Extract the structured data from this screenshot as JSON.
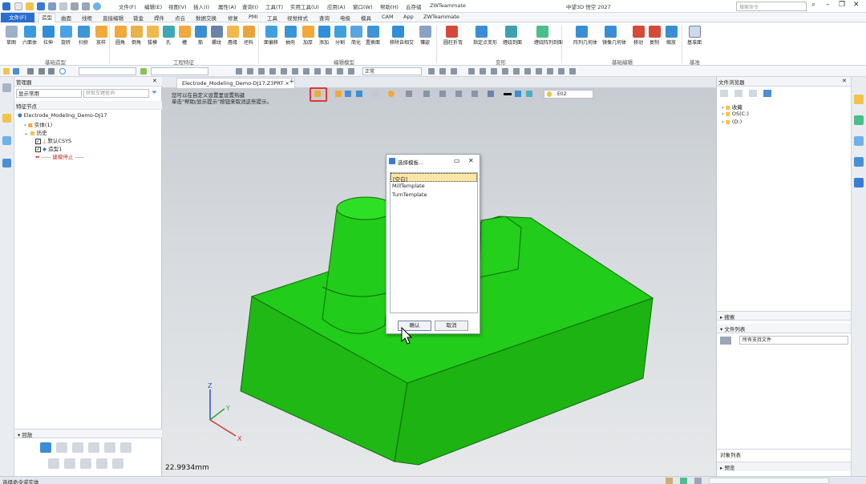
{
  "app": {
    "title": "中望3D 悟空 2027",
    "search_placeholder": "搜索命令"
  },
  "menu": [
    "文件(F)",
    "编辑(E)",
    "视图(V)",
    "插入(I)",
    "属性(A)",
    "查询(I)",
    "工具(T)",
    "实用工具(U)",
    "应用(A)",
    "窗口(W)",
    "帮助(H)",
    "云存储",
    "ZWTeammate"
  ],
  "ribbon_tabs": [
    "文件(F)",
    "造型",
    "曲面",
    "线框",
    "直接编辑",
    "钣金",
    "焊件",
    "点云",
    "数据交换",
    "修复",
    "PMI",
    "工具",
    "视觉样式",
    "查询",
    "电极",
    "模具",
    "CAM",
    "App",
    "ZWTeammate"
  ],
  "active_tab": "造型",
  "ribbon": {
    "basic": {
      "label": "基础造型",
      "buttons": [
        "草图",
        "六面体",
        "拉伸",
        "旋转",
        "扫掠",
        "放样"
      ]
    },
    "eng": {
      "label": "工程特征",
      "buttons": [
        "圆角",
        "倒角",
        "拔模",
        "孔",
        "槽",
        "筋",
        "螺纹",
        "唇缘",
        "坯料"
      ]
    },
    "edit": {
      "label": "编辑模型",
      "buttons": [
        "面偏移",
        "抽壳",
        "加厚",
        "添加",
        "分割",
        "简化",
        "置换面",
        "移除自相交",
        "镶嵌"
      ]
    },
    "deform": {
      "label": "变形",
      "buttons": [
        "圆柱折弯",
        "指定点变形",
        "缠绕到面",
        "缠绕阵列到面"
      ]
    },
    "basicedit": {
      "label": "基础编辑",
      "buttons": [
        "阵列几何体",
        "镜像几何体",
        "移动",
        "复制",
        "缩放"
      ]
    },
    "datum": {
      "label": "基准",
      "buttons": [
        "基准面"
      ]
    }
  },
  "toolrow": {
    "combo1": "",
    "combo2": "",
    "style_combo": "正常"
  },
  "manager": {
    "title": "管理器",
    "filter": "显示常用",
    "search_placeholder": "获取车键查询",
    "section": "特征节点",
    "tree": {
      "root": "Electrode_Modeling_Demo-DJ17",
      "solid": "实体(1)",
      "history": "历史",
      "csys": "默认CSYS",
      "shape": "造型1",
      "stop": "----- 建模停止 -----"
    },
    "playback": "回放"
  },
  "document": {
    "tab": "Electrode_Modeling_Demo-DJ17.Z3PRT",
    "hint1": "您可以在自定义设置里设置热键",
    "hint2": "单击\"帮助/显示提示\"按钮来取消这些提示。",
    "measure": "22.9934mm",
    "view_combo": "E02",
    "axes": {
      "x": "X",
      "y": "Y",
      "z": "Z"
    }
  },
  "dialog": {
    "title": "选择模板...",
    "items": [
      "[空白]",
      "MillTemplate",
      "TurnTemplate"
    ],
    "selected": 0,
    "ok": "确认",
    "cancel": "取消"
  },
  "browser": {
    "title": "文件浏览器",
    "tree": [
      "收藏",
      "OS(C:)",
      "(D:)"
    ],
    "sections": {
      "search": "搜索",
      "filelist": "文件列表",
      "objlist": "对象列表",
      "preview": "预览"
    },
    "filter": "所有支持文件"
  },
  "status": {
    "text": "选择命令或实体"
  },
  "colors": {
    "model": "#22cc1a",
    "model_edge": "#0f6d0a",
    "accent": "#2a6fd0",
    "highlight": "#e03a2e",
    "selection": "#fbe6a8"
  }
}
